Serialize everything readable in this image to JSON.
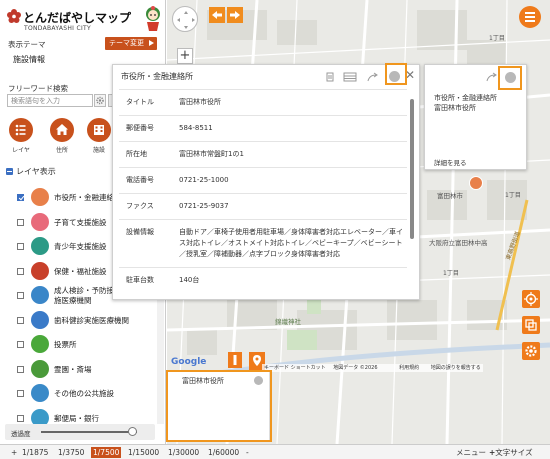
{
  "app": {
    "logo_text": "とんだばやしマップ",
    "logo_sub": "TONDABAYASHI CITY"
  },
  "sidebar": {
    "theme_label": "表示テーマ",
    "theme_value": "施設情報",
    "theme_change_button": "テーマ変更",
    "freeword_label": "フリーワード検索",
    "search_placeholder": "検索語句を入力",
    "tools": [
      {
        "label": "レイヤ",
        "icon": "list-icon"
      },
      {
        "label": "住所",
        "icon": "home-icon"
      },
      {
        "label": "施設",
        "icon": "building-icon"
      }
    ],
    "layer_header": "レイヤ表示",
    "layers": [
      {
        "label": "市役所・金融連絡所",
        "checked": true,
        "icon": "city-hall-icon",
        "color": "#e8804a"
      },
      {
        "label": "子育て支援施設",
        "checked": false,
        "icon": "child-icon",
        "color": "#e86a7a"
      },
      {
        "label": "青少年支援施設",
        "checked": false,
        "icon": "youth-icon",
        "color": "#2c9a86"
      },
      {
        "label": "保健・福祉施設",
        "checked": false,
        "icon": "health-icon",
        "color": "#c8402a"
      },
      {
        "label": "成人検診・予防接種実施医療機関",
        "label_line1": "成人検診・予防接",
        "label_line2": "施医療機関",
        "checked": false,
        "icon": "syringe-icon",
        "color": "#3a86c8"
      },
      {
        "label": "歯科健診実施医療機関",
        "checked": false,
        "icon": "tooth-icon",
        "color": "#3a7ac8"
      },
      {
        "label": "投票所",
        "checked": false,
        "icon": "vote-icon",
        "color": "#4aa83a"
      },
      {
        "label": "霊園・斎場",
        "checked": false,
        "icon": "cemetery-icon",
        "color": "#4a9a3a"
      },
      {
        "label": "その他の公共施設",
        "checked": false,
        "icon": "public-icon",
        "color": "#3a8ac8"
      },
      {
        "label": "郵便局・銀行",
        "checked": false,
        "icon": "post-icon",
        "color": "#3a9ac8"
      }
    ],
    "transparency_label": "透過度",
    "transparency_value": 0.95
  },
  "map": {
    "labels": {
      "town1": "1丁目",
      "town2": "1丁目",
      "town3": "1丁目",
      "school": "大阪府立富田林中高",
      "jinja": "錦織神社",
      "post": "富田林市",
      "road": "東高野街道",
      "city_hall_pin": "富田林市役所"
    },
    "attribution": {
      "google": "Google",
      "shortcuts": "キーボード ショートカット",
      "mapdata": "地図データ ©2026",
      "terms": "利用規約",
      "report": "地図の誤りを報告する"
    }
  },
  "popup_main": {
    "title": "市役所・金融連絡所",
    "rows": [
      {
        "key": "タイトル",
        "value": "富田林市役所"
      },
      {
        "key": "郵便番号",
        "value": "584-8511"
      },
      {
        "key": "所在地",
        "value": "富田林市常盤町1の1"
      },
      {
        "key": "電話番号",
        "value": "0721-25-1000"
      },
      {
        "key": "ファクス",
        "value": "0721-25-9037"
      },
      {
        "key": "設備情報",
        "value": "自動ドア／車椅子使用者用駐車場／身体障害者対応エレベーター／車イス対応トイレ／オストメイト対応トイレ／ベビーキープ／ベビーシート／授乳室／障補動器／点字ブロック身体障害者対応"
      },
      {
        "key": "駐車台数",
        "value": "140台"
      }
    ]
  },
  "popup_small": {
    "line1": "市役所・金融連絡所",
    "line2": "富田林市役所",
    "more": "詳細を見る"
  },
  "info_box": {
    "text": "富田林市役所"
  },
  "bottombar": {
    "scales": [
      "1/1875",
      "1/3750",
      "1/7500",
      "1/15000",
      "1/30000",
      "1/60000"
    ],
    "active_scale": "1/7500",
    "menu_label": "メニュー",
    "fontsize_label": "文字サイズ"
  },
  "colors": {
    "accent": "#c8511c",
    "orange": "#f08c1e",
    "highlight": "#f0961e"
  }
}
